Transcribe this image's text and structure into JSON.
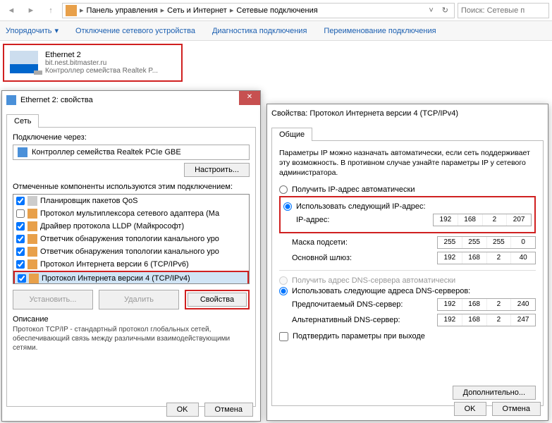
{
  "breadcrumb": {
    "p1": "Панель управления",
    "p2": "Сеть и Интернет",
    "p3": "Сетевые подключения"
  },
  "search_placeholder": "Поиск: Сетевые п",
  "toolbar": {
    "organize": "Упорядочить",
    "disable": "Отключение сетевого устройства",
    "diagnose": "Диагностика подключения",
    "rename": "Переименование подключения"
  },
  "connection": {
    "name": "Ethernet 2",
    "domain": "bit.nest.bitmaster.ru",
    "adapter": "Контроллер семейства Realtek P..."
  },
  "props": {
    "title": "Ethernet 2: свойства",
    "tab": "Сеть",
    "connect_via": "Подключение через:",
    "device": "Контроллер семейства Realtek PCIe GBE",
    "configure": "Настроить...",
    "components_label": "Отмеченные компоненты используются этим подключением:",
    "items": [
      {
        "c": true,
        "i": "mon",
        "t": "Планировщик пакетов QoS"
      },
      {
        "c": false,
        "i": "net",
        "t": "Протокол мультиплексора сетевого адаптера (Ма"
      },
      {
        "c": true,
        "i": "net",
        "t": "Драйвер протокола LLDP (Майкрософт)"
      },
      {
        "c": true,
        "i": "net",
        "t": "Ответчик обнаружения топологии канального уро"
      },
      {
        "c": true,
        "i": "net",
        "t": "Ответчик обнаружения топологии канального уро"
      },
      {
        "c": true,
        "i": "net",
        "t": "Протокол Интернета версии 6 (TCP/IPv6)"
      },
      {
        "c": true,
        "i": "net",
        "t": "Протокол Интернета версии 4 (TCP/IPv4)"
      }
    ],
    "install": "Установить...",
    "remove": "Удалить",
    "properties": "Свойства",
    "desc_title": "Описание",
    "desc": "Протокол TCP/IP - стандартный протокол глобальных сетей, обеспечивающий связь между различными взаимодействующими сетями.",
    "ok": "OK",
    "cancel": "Отмена"
  },
  "ip": {
    "title": "Свойства: Протокол Интернета версии 4 (TCP/IPv4)",
    "tab": "Общие",
    "desc": "Параметры IP можно назначать автоматически, если сеть поддерживает эту возможность. В противном случае узнайте параметры IP у сетевого администратора.",
    "auto_ip": "Получить IP-адрес автоматически",
    "use_ip": "Использовать следующий IP-адрес:",
    "ip_label": "IP-адрес:",
    "ip_val": [
      "192",
      "168",
      "2",
      "207"
    ],
    "mask_label": "Маска подсети:",
    "mask_val": [
      "255",
      "255",
      "255",
      "0"
    ],
    "gw_label": "Основной шлюз:",
    "gw_val": [
      "192",
      "168",
      "2",
      "40"
    ],
    "auto_dns": "Получить адрес DNS-сервера автоматически",
    "use_dns": "Использовать следующие адреса DNS-серверов:",
    "dns1_label": "Предпочитаемый DNS-сервер:",
    "dns1_val": [
      "192",
      "168",
      "2",
      "240"
    ],
    "dns2_label": "Альтернативный DNS-сервер:",
    "dns2_val": [
      "192",
      "168",
      "2",
      "247"
    ],
    "validate": "Подтвердить параметры при выходе",
    "advanced": "Дополнительно...",
    "ok": "OK",
    "cancel": "Отмена"
  }
}
